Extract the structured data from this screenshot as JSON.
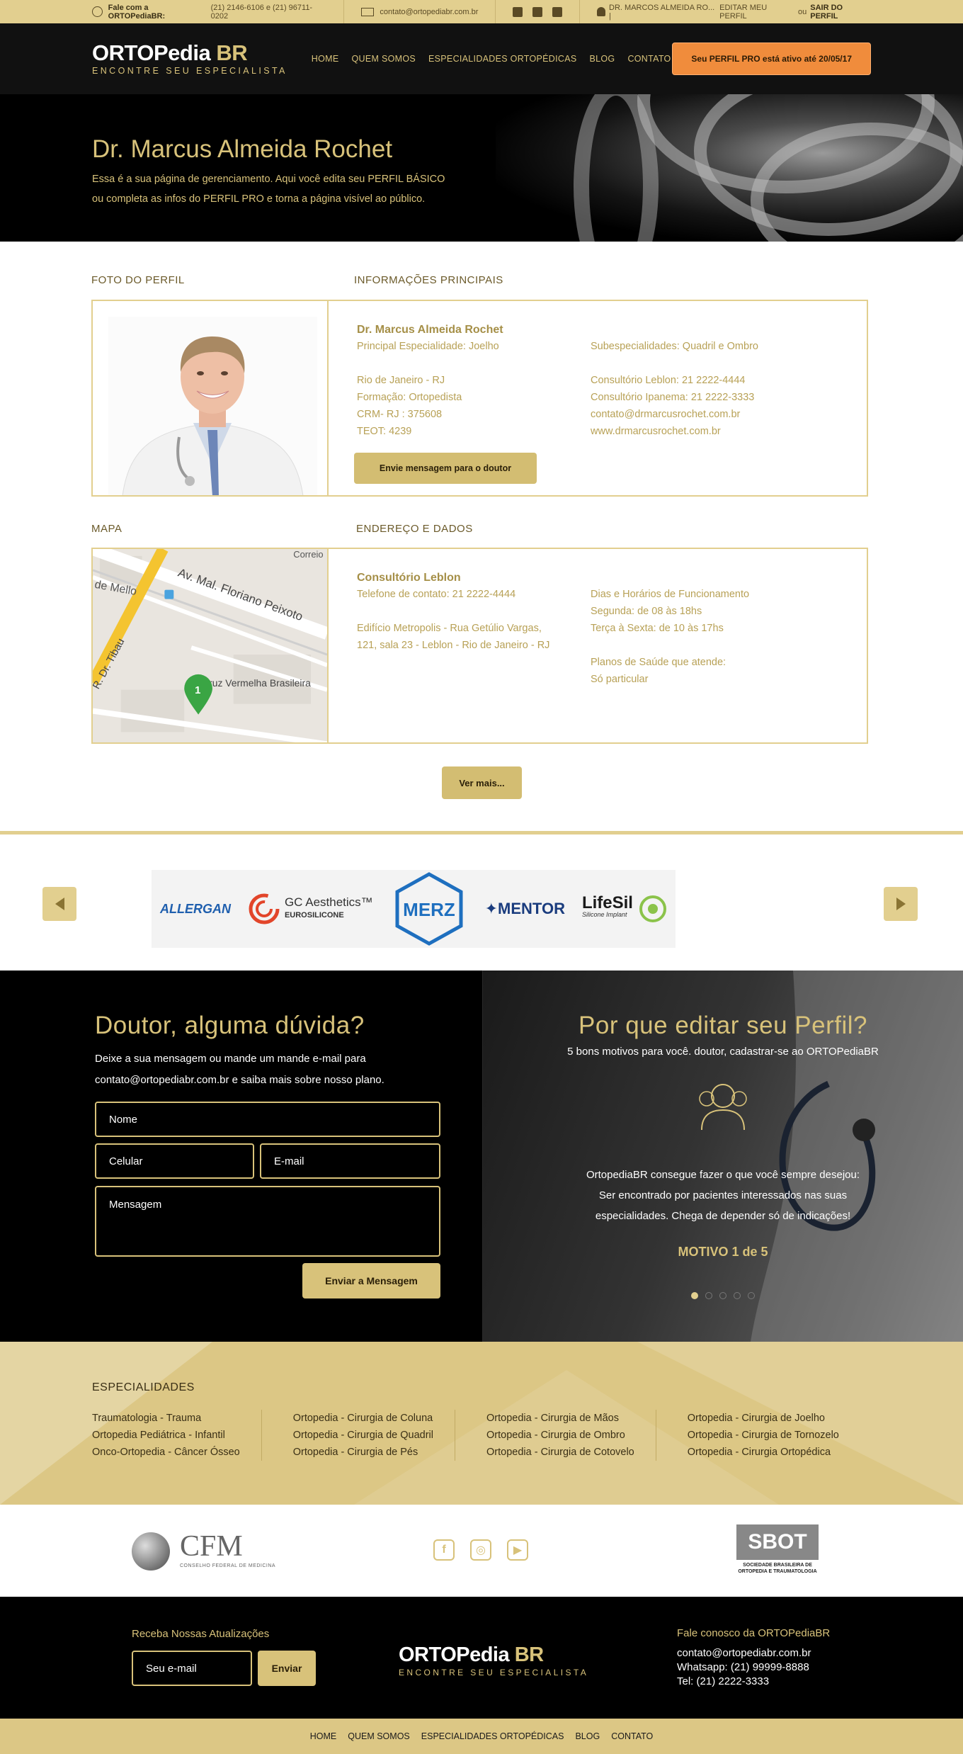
{
  "topbar": {
    "contact_label": "Fale com a ORTOPediaBR:",
    "phones": "(21) 2146-6106 e (21) 96711-0202",
    "email": "contato@ortopediabr.com.br",
    "user": "DR. MARCOS ALMEIDA RO... |",
    "edit_profile": "EDITAR MEU PERFIL",
    "or": "ou",
    "logout": "SAIR DO PERFIL"
  },
  "brand": {
    "name_main": "ORTOPedia",
    "name_suffix": "BR",
    "tagline": "ENCONTRE SEU ESPECIALISTA"
  },
  "nav": {
    "items": [
      "HOME",
      "QUEM SOMOS",
      "ESPECIALIDADES ORTOPÉDICAS",
      "BLOG",
      "CONTATO"
    ],
    "pro_prefix": "Seu",
    "pro_bold": "PERFIL PRO",
    "pro_suffix": "está ativo até 20/05/17"
  },
  "hero": {
    "title": "Dr. Marcus Almeida Rochet",
    "line1": "Essa é a sua página de gerenciamento. Aqui você edita seu PERFIL BÁSICO",
    "line2": "ou completa as infos do PERFIL PRO e torna a página visível ao público."
  },
  "profile": {
    "photo_label": "FOTO DO PERFIL",
    "info_label": "INFORMAÇÕES  PRINCIPAIS",
    "name": "Dr. Marcus Almeida Rochet",
    "specialty": "Principal Especialidade: Joelho",
    "city": "Rio de Janeiro - RJ",
    "formation": "Formação: Ortopedista",
    "crm": "CRM- RJ : 375608",
    "teot": "TEOT: 4239",
    "subspecialties": "Subespecialidades: Quadril e Ombro",
    "phone1": "Consultório Leblon: 21 2222-4444",
    "phone2": "Consultório Ipanema: 21 2222-3333",
    "email": "contato@drmarcusrochet.com.br",
    "site": "www.drmarcusrochet.com.br",
    "message_button": "Envie mensagem para o doutor"
  },
  "address": {
    "map_label": "MAPA",
    "section_label": "ENDEREÇO E DADOS",
    "office": "Consultório Leblon",
    "phone": "Telefone de contato: 21 2222-4444",
    "addr1": "Edifício Metropolis - Rua Getúlio Vargas,",
    "addr2": "121, sala 23 - Leblon - Rio de Janeiro - RJ",
    "hours_title": "Dias e Horários de Funcionamento",
    "hours1": "Segunda: de 08 às 18hs",
    "hours2": "Terça à Sexta: de 10 às 17hs",
    "plans_title": "Planos de Saúde que atende:",
    "plans": "Só particular",
    "map_labels": [
      "Correio",
      "de Mello",
      "Av. Mal. Floriano Peixoto",
      "R. Dr. Tibau",
      "Cruz Vermelha Brasileira"
    ],
    "pin": "1"
  },
  "more_button": "Ver mais...",
  "brands": [
    "ALLERGAN",
    "GC Aesthetics™",
    "EUROSILICONE",
    "MERZ",
    "MENTOR",
    "LifeSil",
    "Silicone Implant"
  ],
  "contact": {
    "title": "Doutor, alguma dúvida?",
    "line1": "Deixe a sua mensagem ou mande um mande e-mail para",
    "line2": "contato@ortopediabr.com.br e saiba mais sobre nosso plano.",
    "name_ph": "Nome",
    "phone_ph": "Celular",
    "email_ph": "E-mail",
    "message_ph": "Mensagem",
    "send": "Enviar a Mensagem"
  },
  "why": {
    "title": "Por que  editar seu Perfil?",
    "subtitle": "5 bons motivos para você. doutor, cadastrar-se ao ORTOPediaBR",
    "text1": "OrtopediaBR consegue fazer o que você sempre desejou:",
    "text2": "Ser encontrado por pacientes interessados nas suas",
    "text3": "especialidades. Chega de depender só de indicações!",
    "motive": "MOTIVO 1 de 5"
  },
  "specialties": {
    "title": "ESPECIALIDADES",
    "columns": [
      [
        "Traumatologia -  Trauma",
        "Ortopedia Pediátrica - Infantil",
        "Onco-Ortopedia - Câncer Ósseo"
      ],
      [
        "Ortopedia - Cirurgia de Coluna",
        "Ortopedia - Cirurgia de Quadril",
        "Ortopedia - Cirurgia de Pés"
      ],
      [
        "Ortopedia - Cirurgia de Mãos",
        "Ortopedia - Cirurgia de Ombro",
        "Ortopedia - Cirurgia de Cotovelo"
      ],
      [
        "Ortopedia - Cirurgia de Joelho",
        "Ortopedia - Cirurgia de Tornozelo",
        "Ortopedia - Cirurgia Ortopédica"
      ]
    ]
  },
  "partners": {
    "cfm": "CFM",
    "cfm_sub": "CONSELHO FEDERAL DE MEDICINA",
    "sbot": "SBOT",
    "sbot_sub1": "SOCIEDADE BRASILEIRA DE",
    "sbot_sub2": "ORTOPEDIA E TRAUMATOLOGIA"
  },
  "footer": {
    "newsletter_title": "Receba Nossas Atualizações",
    "email_ph": "Seu e-mail",
    "send": "Enviar",
    "contact_title": "Fale conosco da ORTOPediaBR",
    "email": "contato@ortopediabr.com.br",
    "whatsapp": "Whatsapp: (21) 99999-8888",
    "tel": "Tel: (21) 2222-3333"
  }
}
